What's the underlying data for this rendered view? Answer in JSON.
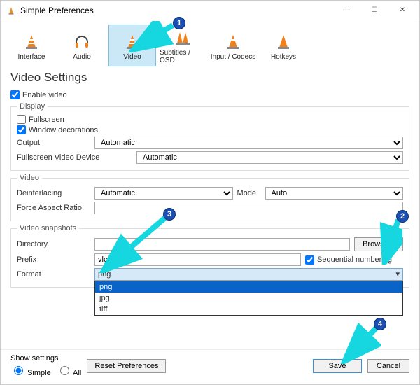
{
  "titlebar": {
    "title": "Simple Preferences"
  },
  "categories": [
    {
      "label": "Interface",
      "icon": "cone"
    },
    {
      "label": "Audio",
      "icon": "headphones"
    },
    {
      "label": "Video",
      "icon": "cone",
      "selected": true
    },
    {
      "label": "Subtitles / OSD",
      "icon": "cone-pair"
    },
    {
      "label": "Input / Codecs",
      "icon": "cone"
    },
    {
      "label": "Hotkeys",
      "icon": "cone"
    }
  ],
  "section_title": "Video Settings",
  "enable_video": {
    "label": "Enable video",
    "checked": true
  },
  "display": {
    "legend": "Display",
    "fullscreen": {
      "label": "Fullscreen",
      "checked": false
    },
    "window_decorations": {
      "label": "Window decorations",
      "checked": true
    },
    "output": {
      "label": "Output",
      "value": "Automatic"
    },
    "fs_device": {
      "label": "Fullscreen Video Device",
      "value": "Automatic"
    }
  },
  "video": {
    "legend": "Video",
    "deinterlacing": {
      "label": "Deinterlacing",
      "value": "Automatic"
    },
    "mode": {
      "label": "Mode",
      "value": "Auto"
    },
    "force_ar": {
      "label": "Force Aspect Ratio",
      "value": ""
    }
  },
  "snapshots": {
    "legend": "Video snapshots",
    "directory": {
      "label": "Directory",
      "value": "",
      "browse": "Browse..."
    },
    "prefix": {
      "label": "Prefix",
      "value": "vlcsnap-",
      "seq": "Sequential numbering",
      "seq_checked": true
    },
    "format": {
      "label": "Format",
      "value": "png",
      "options": [
        "png",
        "jpg",
        "tiff"
      ],
      "open": true,
      "highlight_index": 0,
      "selected_index": 0
    }
  },
  "footer": {
    "show_settings": "Show settings",
    "simple": "Simple",
    "all": "All",
    "mode": "simple",
    "reset": "Reset Preferences",
    "save": "Save",
    "cancel": "Cancel"
  },
  "annotations": [
    {
      "n": "1",
      "target": "video-tab"
    },
    {
      "n": "2",
      "target": "format-arrow"
    },
    {
      "n": "3",
      "target": "format-option-png"
    },
    {
      "n": "4",
      "target": "save-button"
    }
  ]
}
